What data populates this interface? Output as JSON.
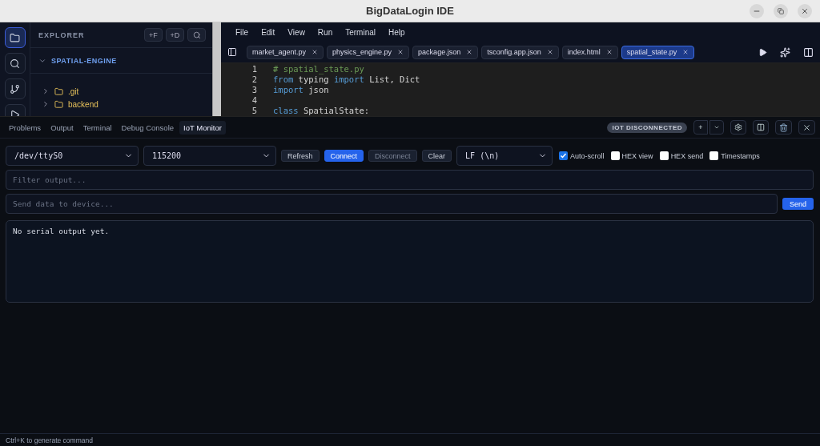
{
  "window": {
    "title": "BigDataLogin IDE"
  },
  "activity_bar": [
    {
      "selected": true
    },
    {
      "selected": false
    },
    {
      "selected": false
    },
    {
      "selected": false
    }
  ],
  "explorer": {
    "title": "EXPLORER",
    "actions": [
      "+F",
      "+D"
    ],
    "project": "SPATIAL-ENGINE",
    "items": [
      {
        "name": ".git",
        "expanded": false
      },
      {
        "name": "backend",
        "expanded": false
      }
    ]
  },
  "menu": [
    "File",
    "Edit",
    "View",
    "Run",
    "Terminal",
    "Help"
  ],
  "tabs": [
    {
      "label": "market_agent.py",
      "selected": false
    },
    {
      "label": "physics_engine.py",
      "selected": false
    },
    {
      "label": "package.json",
      "selected": false
    },
    {
      "label": "tsconfig.app.json",
      "selected": false
    },
    {
      "label": "index.html",
      "selected": false
    },
    {
      "label": "spatial_state.py",
      "selected": true
    }
  ],
  "code": [
    {
      "n": "1",
      "tokens": [
        {
          "t": "# spatial_state.py",
          "kind": "comment"
        }
      ]
    },
    {
      "n": "2",
      "tokens": [
        {
          "t": "from",
          "kind": "keyword"
        },
        {
          "t": " typing ",
          "kind": "plain"
        },
        {
          "t": "import",
          "kind": "keyword"
        },
        {
          "t": " List, Dict",
          "kind": "plain"
        }
      ]
    },
    {
      "n": "3",
      "tokens": [
        {
          "t": "import",
          "kind": "keyword"
        },
        {
          "t": " json",
          "kind": "plain"
        }
      ]
    },
    {
      "n": "4"
    },
    {
      "n": "5",
      "tokens": [
        {
          "t": "class",
          "kind": "keyword"
        },
        {
          "t": " SpatialState:",
          "kind": "plain"
        }
      ]
    }
  ],
  "panel": {
    "tabs": [
      {
        "label": "Problems",
        "selected": false
      },
      {
        "label": "Output",
        "selected": false
      },
      {
        "label": "Terminal",
        "selected": false
      },
      {
        "label": "Debug Console",
        "selected": false
      },
      {
        "label": "IoT Monitor",
        "selected": true
      }
    ],
    "status": "IOT DISCONNECTED",
    "add": "+",
    "port": "/dev/ttyS0",
    "baud": "115200",
    "buttons": [
      {
        "label": "Refresh",
        "kind": "secondary",
        "disabled": false
      },
      {
        "label": "Connect",
        "kind": "primary",
        "disabled": false
      },
      {
        "label": "Disconnect",
        "kind": "secondary",
        "disabled": true
      },
      {
        "label": "Clear",
        "kind": "secondary",
        "disabled": false
      }
    ],
    "line_ending": "LF (\\n)",
    "options": [
      {
        "label": "Auto-scroll",
        "checked": true
      },
      {
        "label": "HEX view",
        "checked": false
      },
      {
        "label": "HEX send",
        "checked": false
      },
      {
        "label": "Timestamps",
        "checked": false
      }
    ],
    "filter": {
      "placeholder": "Filter output..."
    },
    "send_field": {
      "placeholder": "Send data to device..."
    },
    "send": "Send",
    "output": "No serial output yet."
  },
  "status_bar": "Ctrl+K to generate command"
}
